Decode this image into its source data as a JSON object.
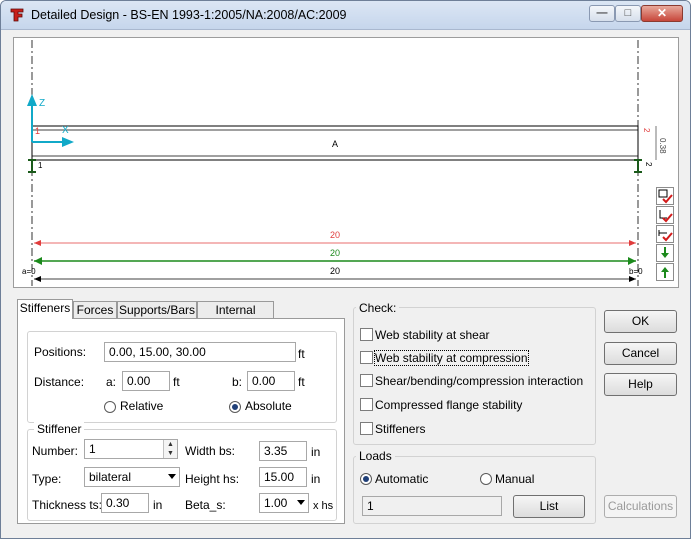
{
  "window": {
    "title": "Detailed Design - BS-EN 1993-1:2005/NA:2008/AC:2009",
    "controls": {
      "minimize": "—",
      "maximize": "□",
      "close": "✕"
    },
    "icon": "robot-logo-icon"
  },
  "drawing": {
    "axis_z": "Z",
    "axis_x": "X",
    "beam_label": "A",
    "height_dim": "0.38",
    "node_left": "1",
    "node_right": "2",
    "mark_left_red": "1",
    "mark_right_red": "2",
    "dim_red": "20",
    "dim_green": "20",
    "dim_black": "20",
    "a_label": "a=0",
    "b_label": "b=0",
    "colors": {
      "red": "#e03c3c",
      "green": "#1c8a1c",
      "cyan": "#11a9c8"
    }
  },
  "tabs": [
    {
      "label": "Stiffeners"
    },
    {
      "label": "Forces"
    },
    {
      "label": "Supports/Bars"
    },
    {
      "label": "Internal forces"
    }
  ],
  "stiffeners": {
    "positions_label": "Positions:",
    "positions_value": "0.00, 15.00, 30.00",
    "positions_unit": "ft",
    "distance_label": "Distance:",
    "a_label": "a:",
    "a_value": "0.00",
    "a_unit": "ft",
    "b_label": "b:",
    "b_value": "0.00",
    "b_unit": "ft",
    "relative_label": "Relative",
    "absolute_label": "Absolute",
    "mode_selected": "Absolute",
    "group_title": "Stiffener",
    "number_label": "Number:",
    "number_value": "1",
    "type_label": "Type:",
    "type_value": "bilateral",
    "thickness_label": "Thickness ts:",
    "thickness_value": "0.30",
    "thickness_unit": "in",
    "width_label": "Width bs:",
    "width_value": "3.35",
    "width_unit": "in",
    "height_label": "Height hs:",
    "height_value": "15.00",
    "height_unit": "in",
    "beta_label": "Beta_s:",
    "beta_value": "1.00",
    "beta_unit": "x  hs"
  },
  "check": {
    "title": "Check:",
    "items": [
      {
        "label": "Web stability at shear",
        "checked": false
      },
      {
        "label": "Web stability at compression",
        "checked": false
      },
      {
        "label": "Shear/bending/compression interaction",
        "checked": false
      },
      {
        "label": "Compressed flange stability",
        "checked": false
      },
      {
        "label": "Stiffeners",
        "checked": false
      }
    ]
  },
  "loads": {
    "title": "Loads",
    "automatic_label": "Automatic",
    "manual_label": "Manual",
    "selected": "Automatic",
    "case_value": "1",
    "list_label": "List"
  },
  "buttons": {
    "ok": "OK",
    "cancel": "Cancel",
    "help": "Help",
    "calculations": "Calculations"
  }
}
